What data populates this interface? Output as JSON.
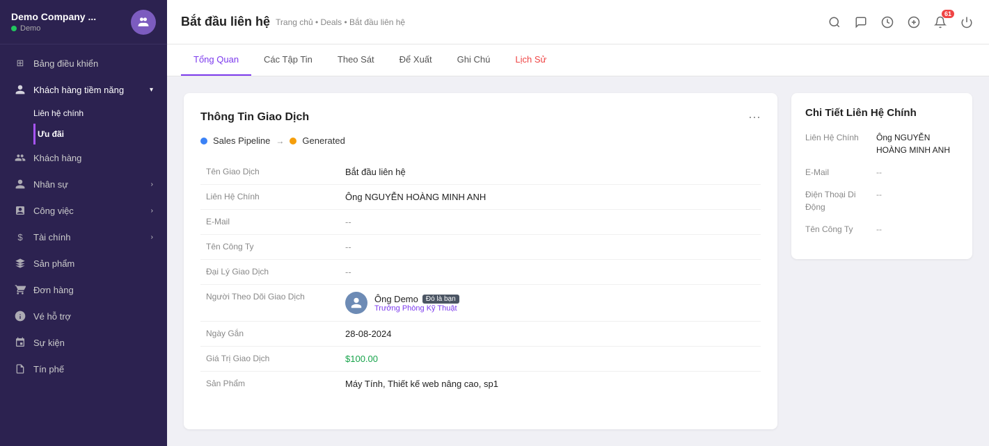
{
  "sidebar": {
    "company_name": "Demo Company ...",
    "demo_label": "Demo",
    "items": [
      {
        "id": "dashboard",
        "label": "Bảng điều khiển",
        "icon": "⊞",
        "has_chevron": false
      },
      {
        "id": "potential-customers",
        "label": "Khách hàng tiềm năng",
        "icon": "👤",
        "has_chevron": true,
        "expanded": true,
        "sub_items": [
          {
            "id": "contacts",
            "label": "Liên hệ chính",
            "active": false
          },
          {
            "id": "deals",
            "label": "Ưu đãi",
            "active": true
          }
        ]
      },
      {
        "id": "customers",
        "label": "Khách hàng",
        "icon": "👥",
        "has_chevron": false
      },
      {
        "id": "hr",
        "label": "Nhân sự",
        "icon": "🧑‍🤝‍🧑",
        "has_chevron": true
      },
      {
        "id": "tasks",
        "label": "Công việc",
        "icon": "🗂",
        "has_chevron": true
      },
      {
        "id": "finance",
        "label": "Tài chính",
        "icon": "$",
        "has_chevron": true
      },
      {
        "id": "products",
        "label": "Sản phẩm",
        "icon": "🛍",
        "has_chevron": false
      },
      {
        "id": "orders",
        "label": "Đơn hàng",
        "icon": "🛒",
        "has_chevron": false
      },
      {
        "id": "support",
        "label": "Vé hỗ trợ",
        "icon": "🎧",
        "has_chevron": false
      },
      {
        "id": "events",
        "label": "Sự kiện",
        "icon": "📅",
        "has_chevron": false
      },
      {
        "id": "tipsheet",
        "label": "Tín phế",
        "icon": "📋",
        "has_chevron": false
      }
    ]
  },
  "topbar": {
    "title": "Bắt đầu liên hệ",
    "breadcrumb": "Trang chủ • Deals • Bắt đầu liên hệ",
    "notification_count": "61"
  },
  "tabs": [
    {
      "id": "tong-quan",
      "label": "Tổng Quan",
      "active": true
    },
    {
      "id": "cac-tap-tin",
      "label": "Các Tập Tin",
      "active": false
    },
    {
      "id": "theo-sat",
      "label": "Theo Sát",
      "active": false
    },
    {
      "id": "de-xuat",
      "label": "Để Xuất",
      "active": false
    },
    {
      "id": "ghi-chu",
      "label": "Ghi Chú",
      "active": false
    },
    {
      "id": "lich-su",
      "label": "Lịch Sử",
      "active": false,
      "red": true
    }
  ],
  "deal_card": {
    "title": "Thông Tin Giao Dịch",
    "pipeline_from": "Sales Pipeline",
    "pipeline_to": "Generated",
    "fields": [
      {
        "label": "Tên Giao Dịch",
        "value": "Bắt đầu liên hệ",
        "type": "text"
      },
      {
        "label": "Liên Hệ Chính",
        "value": "Ông NGUYỄN HOÀNG MINH ANH",
        "type": "text"
      },
      {
        "label": "E-Mail",
        "value": "--",
        "type": "muted"
      },
      {
        "label": "Tên Công Ty",
        "value": "--",
        "type": "muted"
      },
      {
        "label": "Đại Lý Giao Dịch",
        "value": "--",
        "type": "muted"
      },
      {
        "label": "Người Theo Dõi Giao Dịch",
        "value": "",
        "type": "follower"
      },
      {
        "label": "Ngày Gắn",
        "value": "28-08-2024",
        "type": "text"
      },
      {
        "label": "Giá Trị Giao Dịch",
        "value": "$100.00",
        "type": "green"
      },
      {
        "label": "Sản Phẩm",
        "value": "Máy Tính, Thiết kế web nâng cao, sp1",
        "type": "text"
      }
    ],
    "follower": {
      "name": "Ông Demo",
      "badge": "Đó là bạn",
      "title": "Trưởng Phòng Kỹ Thuật"
    }
  },
  "right_panel": {
    "title": "Chi Tiết Liên Hệ Chính",
    "fields": [
      {
        "label": "Liên Hệ Chính",
        "value": "Ông NGUYỄN HOÀNG MINH ANH"
      },
      {
        "label": "E-Mail",
        "value": "--"
      },
      {
        "label": "Điện Thoại Di Động",
        "value": "--"
      },
      {
        "label": "Tên Công Ty",
        "value": "--"
      }
    ]
  }
}
